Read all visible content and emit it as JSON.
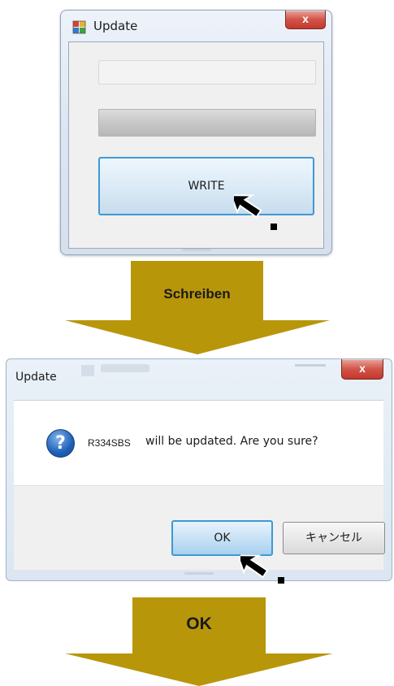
{
  "update_window": {
    "title": "Update",
    "close_label": "x",
    "write_button_label": "WRITE"
  },
  "step1": {
    "label": "Schreiben"
  },
  "confirm_dialog": {
    "title": "Update",
    "close_label": "x",
    "question_glyph": "?",
    "message_prefix": "R334SBS",
    "message": "will be updated. Are you sure?",
    "ok_label": "OK",
    "cancel_label": "キャンセル"
  },
  "step2": {
    "label": "OK"
  },
  "colors": {
    "arrow": "#b8960a",
    "button_focus_border": "#3d9ad4",
    "close_button": "#c4372c"
  },
  "icons": [
    "app-icon",
    "close-icon",
    "question-icon",
    "cursor-icon"
  ]
}
